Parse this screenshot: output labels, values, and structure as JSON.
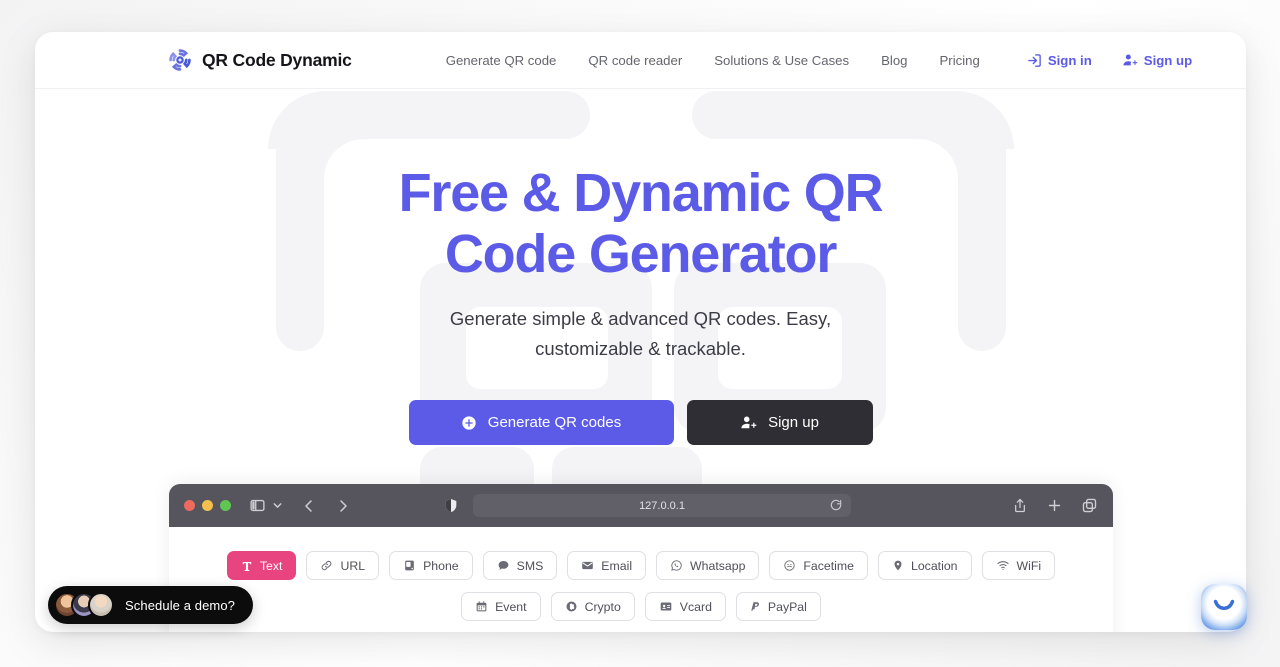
{
  "brand": {
    "name": "QR Code Dynamic",
    "logo_icon": "qr-swirl-logo",
    "accent": "#5b5be8"
  },
  "nav": {
    "links": [
      {
        "label": "Generate QR code"
      },
      {
        "label": "QR code reader"
      },
      {
        "label": "Solutions & Use Cases"
      },
      {
        "label": "Blog"
      },
      {
        "label": "Pricing"
      }
    ],
    "auth": [
      {
        "label": "Sign in",
        "icon": "sign-in-icon"
      },
      {
        "label": "Sign up",
        "icon": "user-plus-icon"
      }
    ]
  },
  "hero": {
    "title_line1": "Free & Dynamic QR",
    "title_line2": "Code Generator",
    "subtitle_line1": "Generate simple & advanced QR codes. Easy,",
    "subtitle_line2": "customizable & trackable.",
    "primary_button": {
      "label": "Generate QR codes",
      "icon": "plus-circle-icon",
      "color": "#5b5be8"
    },
    "secondary_button": {
      "label": "Sign up",
      "icon": "user-plus-icon",
      "color": "#2e2e34"
    }
  },
  "browser": {
    "url": "127.0.0.1",
    "traffic_lights": [
      "#ec6a5e",
      "#f4bf4f",
      "#61c554"
    ],
    "toolbar_icons": [
      "sidebar-toggle-icon",
      "chevron-down-icon",
      "back-arrow-icon",
      "forward-arrow-icon",
      "shield-privacy-icon",
      "reload-icon",
      "share-icon",
      "new-tab-icon",
      "tab-overview-icon"
    ]
  },
  "qr_types": {
    "row1": [
      {
        "label": "Text",
        "icon": "text-icon",
        "active": true
      },
      {
        "label": "URL",
        "icon": "link-icon",
        "active": false
      },
      {
        "label": "Phone",
        "icon": "phone-icon",
        "active": false
      },
      {
        "label": "SMS",
        "icon": "chat-bubble-icon",
        "active": false
      },
      {
        "label": "Email",
        "icon": "envelope-icon",
        "active": false
      },
      {
        "label": "Whatsapp",
        "icon": "whatsapp-icon",
        "active": false
      },
      {
        "label": "Facetime",
        "icon": "facetime-icon",
        "active": false
      },
      {
        "label": "Location",
        "icon": "pin-icon",
        "active": false
      },
      {
        "label": "WiFi",
        "icon": "wifi-icon",
        "active": false
      }
    ],
    "row2": [
      {
        "label": "Event",
        "icon": "calendar-icon",
        "active": false
      },
      {
        "label": "Crypto",
        "icon": "coin-icon",
        "active": false
      },
      {
        "label": "Vcard",
        "icon": "id-card-icon",
        "active": false
      },
      {
        "label": "PayPal",
        "icon": "paypal-icon",
        "active": false
      }
    ],
    "active_color": "#e8447f"
  },
  "demo_widget": {
    "label": "Schedule a demo?",
    "avatar_count": 3
  },
  "chat_widget": {
    "icon": "chat-smile-icon"
  }
}
